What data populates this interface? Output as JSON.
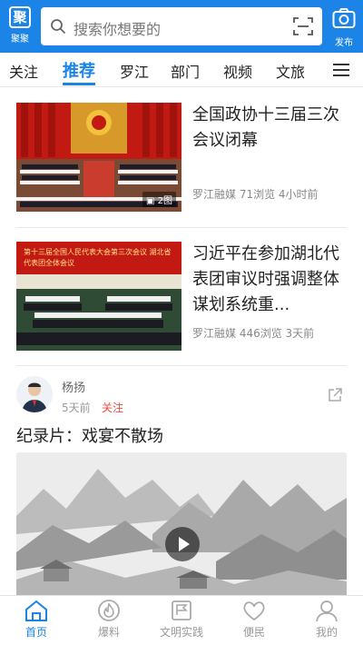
{
  "header": {
    "app_name": "聚聚",
    "logo_glyph": "聚",
    "search_placeholder": "搜索你想要的",
    "publish_label": "发布",
    "accent_color": "#1b84e6"
  },
  "tabs": [
    {
      "label": "关注"
    },
    {
      "label": "推荐",
      "active": true
    },
    {
      "label": "罗江"
    },
    {
      "label": "部门"
    },
    {
      "label": "视频"
    },
    {
      "label": "文旅"
    }
  ],
  "feed": {
    "articles": [
      {
        "title": "全国政协十三届三次会议闭幕",
        "meta": "罗江融媒 71浏览 4小时前",
        "image_badge": "2图"
      },
      {
        "title": "习近平在参加湖北代表团审议时强调整体谋划系统重...",
        "meta": "罗江融媒 446浏览 3天前",
        "banner_text": "第十三届全国人民代表大会第三次会议 湖北省代表团全体会议"
      }
    ],
    "post": {
      "author": "杨扬",
      "time": "5天前",
      "follow_label": "关注",
      "title": "纪录片：戏宴不散场"
    }
  },
  "bottom_nav": [
    {
      "label": "首页",
      "icon": "home-icon",
      "active": true
    },
    {
      "label": "爆料",
      "icon": "fire-icon"
    },
    {
      "label": "文明实践",
      "icon": "flag-icon"
    },
    {
      "label": "便民",
      "icon": "heart-icon"
    },
    {
      "label": "我的",
      "icon": "user-icon"
    }
  ]
}
